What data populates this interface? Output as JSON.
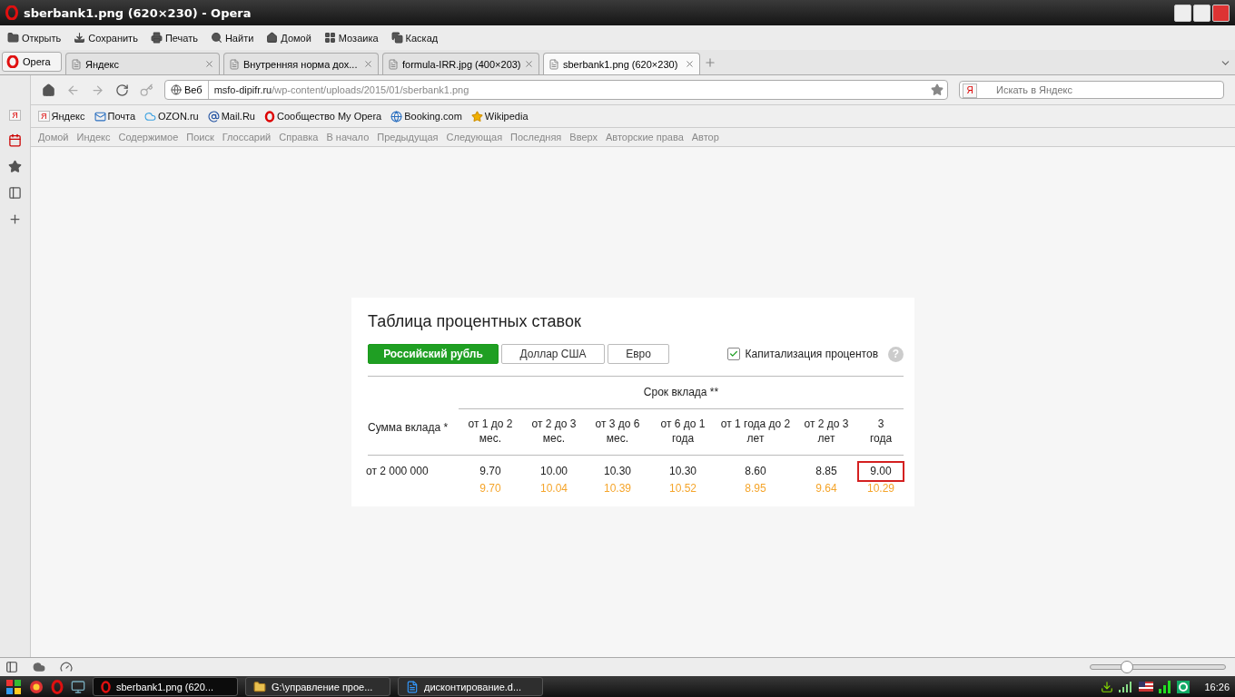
{
  "window": {
    "title": "sberbank1.png (620×230) - Opera"
  },
  "toolbar": [
    "Открыть",
    "Сохранить",
    "Печать",
    "Найти",
    "Домой",
    "Мозаика",
    "Каскад"
  ],
  "opera_menu": "Opera",
  "tabs": [
    {
      "label": "Яндекс",
      "selected": false
    },
    {
      "label": "Внутренняя норма дох...",
      "selected": false
    },
    {
      "label": "formula-IRR.jpg (400×203)",
      "selected": false
    },
    {
      "label": "sberbank1.png (620×230)",
      "selected": true
    }
  ],
  "address": {
    "scope": "Веб",
    "host": "msfo-dipifr.ru",
    "path": "/wp-content/uploads/2015/01/sberbank1.png"
  },
  "sidebar": [
    {
      "mark": "Я"
    }
  ],
  "search": {
    "engine": "Я",
    "placeholder": "Искать в Яндекс"
  },
  "bookmarks": [
    {
      "label": "Яндекс",
      "mark": "Я"
    },
    {
      "label": "Почта"
    },
    {
      "label": "OZON.ru"
    },
    {
      "label": "Mail.Ru"
    },
    {
      "label": "Сообщество My Opera"
    },
    {
      "label": "Booking.com"
    },
    {
      "label": "Wikipedia"
    }
  ],
  "nav_links": [
    "Домой",
    "Индекс",
    "Содержимое",
    "Поиск",
    "Глоссарий",
    "Справка",
    "В начало",
    "Предыдущая",
    "Следующая",
    "Последняя",
    "Вверх",
    "Авторские права",
    "Автор"
  ],
  "image": {
    "title": "Таблица процентных ставок",
    "currencies": [
      {
        "label": "Российский рубль",
        "selected": true
      },
      {
        "label": "Доллар США",
        "selected": false
      },
      {
        "label": "Евро",
        "selected": false
      }
    ],
    "capitalization": {
      "label": "Капитализация процентов",
      "checked": true
    },
    "help": "?",
    "term_header": "Срок вклада **",
    "amount_header": "Сумма вклада *",
    "columns": [
      {
        "lines": [
          "от 1 до 2",
          "мес."
        ]
      },
      {
        "lines": [
          "от 2 до 3",
          "мес."
        ]
      },
      {
        "lines": [
          "от 3 до 6",
          "мес."
        ]
      },
      {
        "lines": [
          "от 6 до 1",
          "года"
        ]
      },
      {
        "lines": [
          "от 1 года до 2",
          "лет"
        ]
      },
      {
        "lines": [
          "от 2 до 3",
          "лет"
        ]
      },
      {
        "lines": [
          "3",
          "года"
        ]
      }
    ],
    "rows": [
      {
        "amount": "от 2 000 000",
        "cells": [
          {
            "rate": "9.70",
            "effective": "9.70",
            "highlighted": false
          },
          {
            "rate": "10.00",
            "effective": "10.04",
            "highlighted": false
          },
          {
            "rate": "10.30",
            "effective": "10.39",
            "highlighted": false
          },
          {
            "rate": "10.30",
            "effective": "10.52",
            "highlighted": false
          },
          {
            "rate": "8.60",
            "effective": "8.95",
            "highlighted": false
          },
          {
            "rate": "8.85",
            "effective": "9.64",
            "highlighted": false
          },
          {
            "rate": "9.00",
            "effective": "10.29",
            "highlighted": true
          }
        ]
      }
    ]
  },
  "zoom_slider": {
    "level": 0.27
  },
  "taskbar": [
    {
      "label": "sberbank1.png (620...",
      "selected": true
    },
    {
      "label": "G:\\управление прое...",
      "selected": false
    },
    {
      "label": "дисконтирование.d...",
      "selected": false
    }
  ],
  "clock": "16:26"
}
